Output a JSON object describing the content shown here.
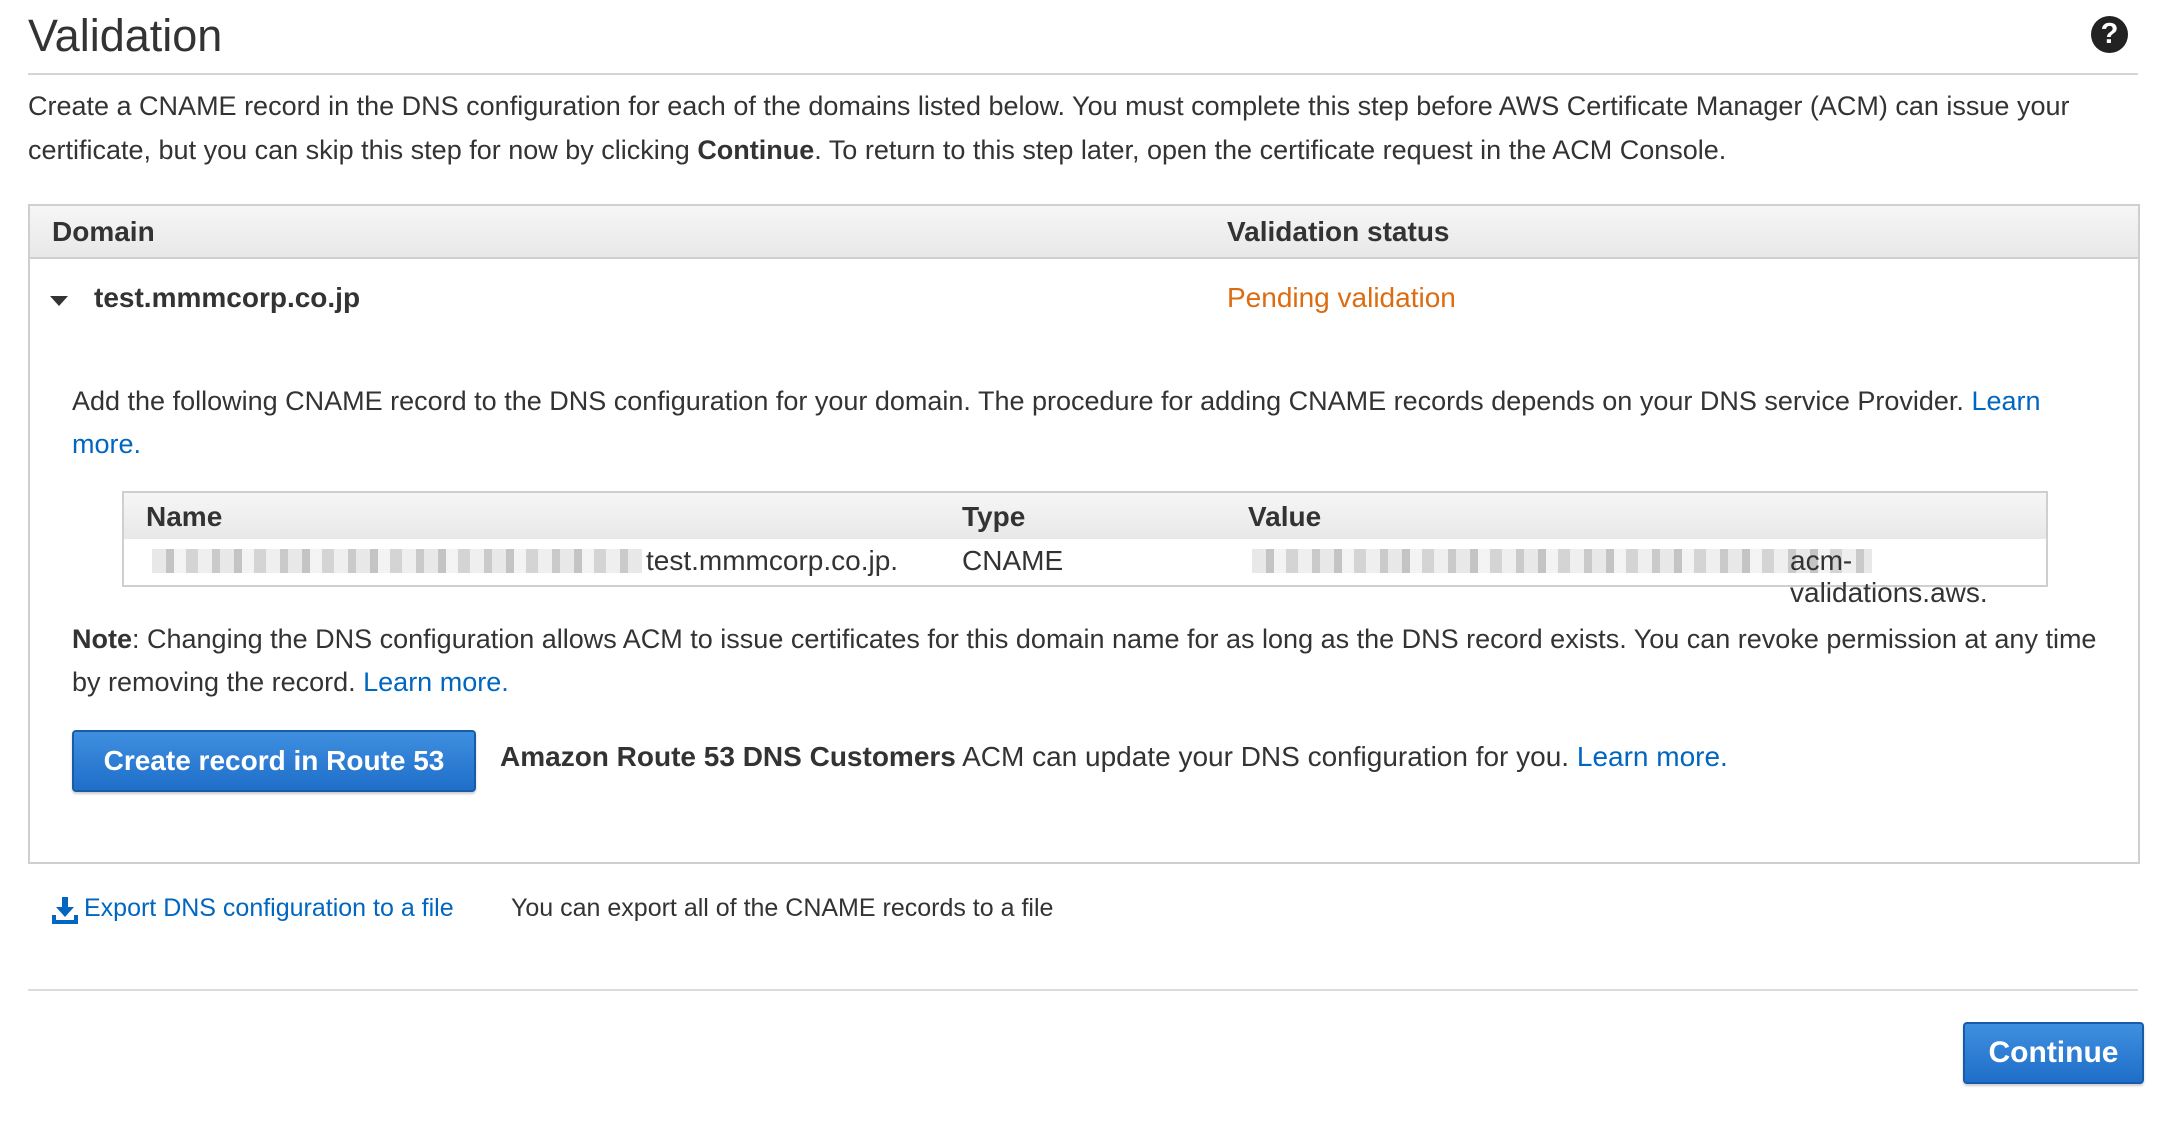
{
  "header": {
    "title": "Validation",
    "help_icon": "question-circle-icon",
    "help_symbol": "?"
  },
  "intro": {
    "text_before": "Create a CNAME record in the DNS configuration for each of the domains listed below. You must complete this step before AWS Certificate Manager (ACM) can issue your certificate, but you can skip this step for now by clicking ",
    "bold": "Continue",
    "text_after": ". To return to this step later, open the certificate request in the ACM Console."
  },
  "table": {
    "col_domain": "Domain",
    "col_status": "Validation status",
    "rows": [
      {
        "domain": "test.mmmcorp.co.jp",
        "status": "Pending validation",
        "status_color": "#dd6b10",
        "expanded": true
      }
    ]
  },
  "detail": {
    "text": "Add the following CNAME record to the DNS configuration for your domain. The procedure for adding CNAME records depends on your DNS service Provider. ",
    "learn_more": "Learn more.",
    "cname": {
      "col_name": "Name",
      "col_type": "Type",
      "col_value": "Value",
      "name_suffix": "test.mmmcorp.co.jp.",
      "type": "CNAME",
      "value_suffix": "acm-validations.aws."
    },
    "note_label": "Note",
    "note_text": ": Changing the DNS configuration allows ACM to issue certificates for this domain name for as long as the DNS record exists. You can revoke permission at any time by removing the record. ",
    "note_learn_more": "Learn more.",
    "route53_button": "Create record in Route 53",
    "route53_bold": "Amazon Route 53 DNS Customers",
    "route53_text": " ACM can update your DNS configuration for you. ",
    "route53_learn_more": "Learn more."
  },
  "export": {
    "icon": "download-icon",
    "link": "Export DNS configuration to a file",
    "description": "You can export all of the CNAME records to a file"
  },
  "footer": {
    "continue_button": "Continue"
  },
  "colors": {
    "link": "#0066c0",
    "primary_button": "#1f6ec9",
    "pending": "#dd6b10"
  }
}
